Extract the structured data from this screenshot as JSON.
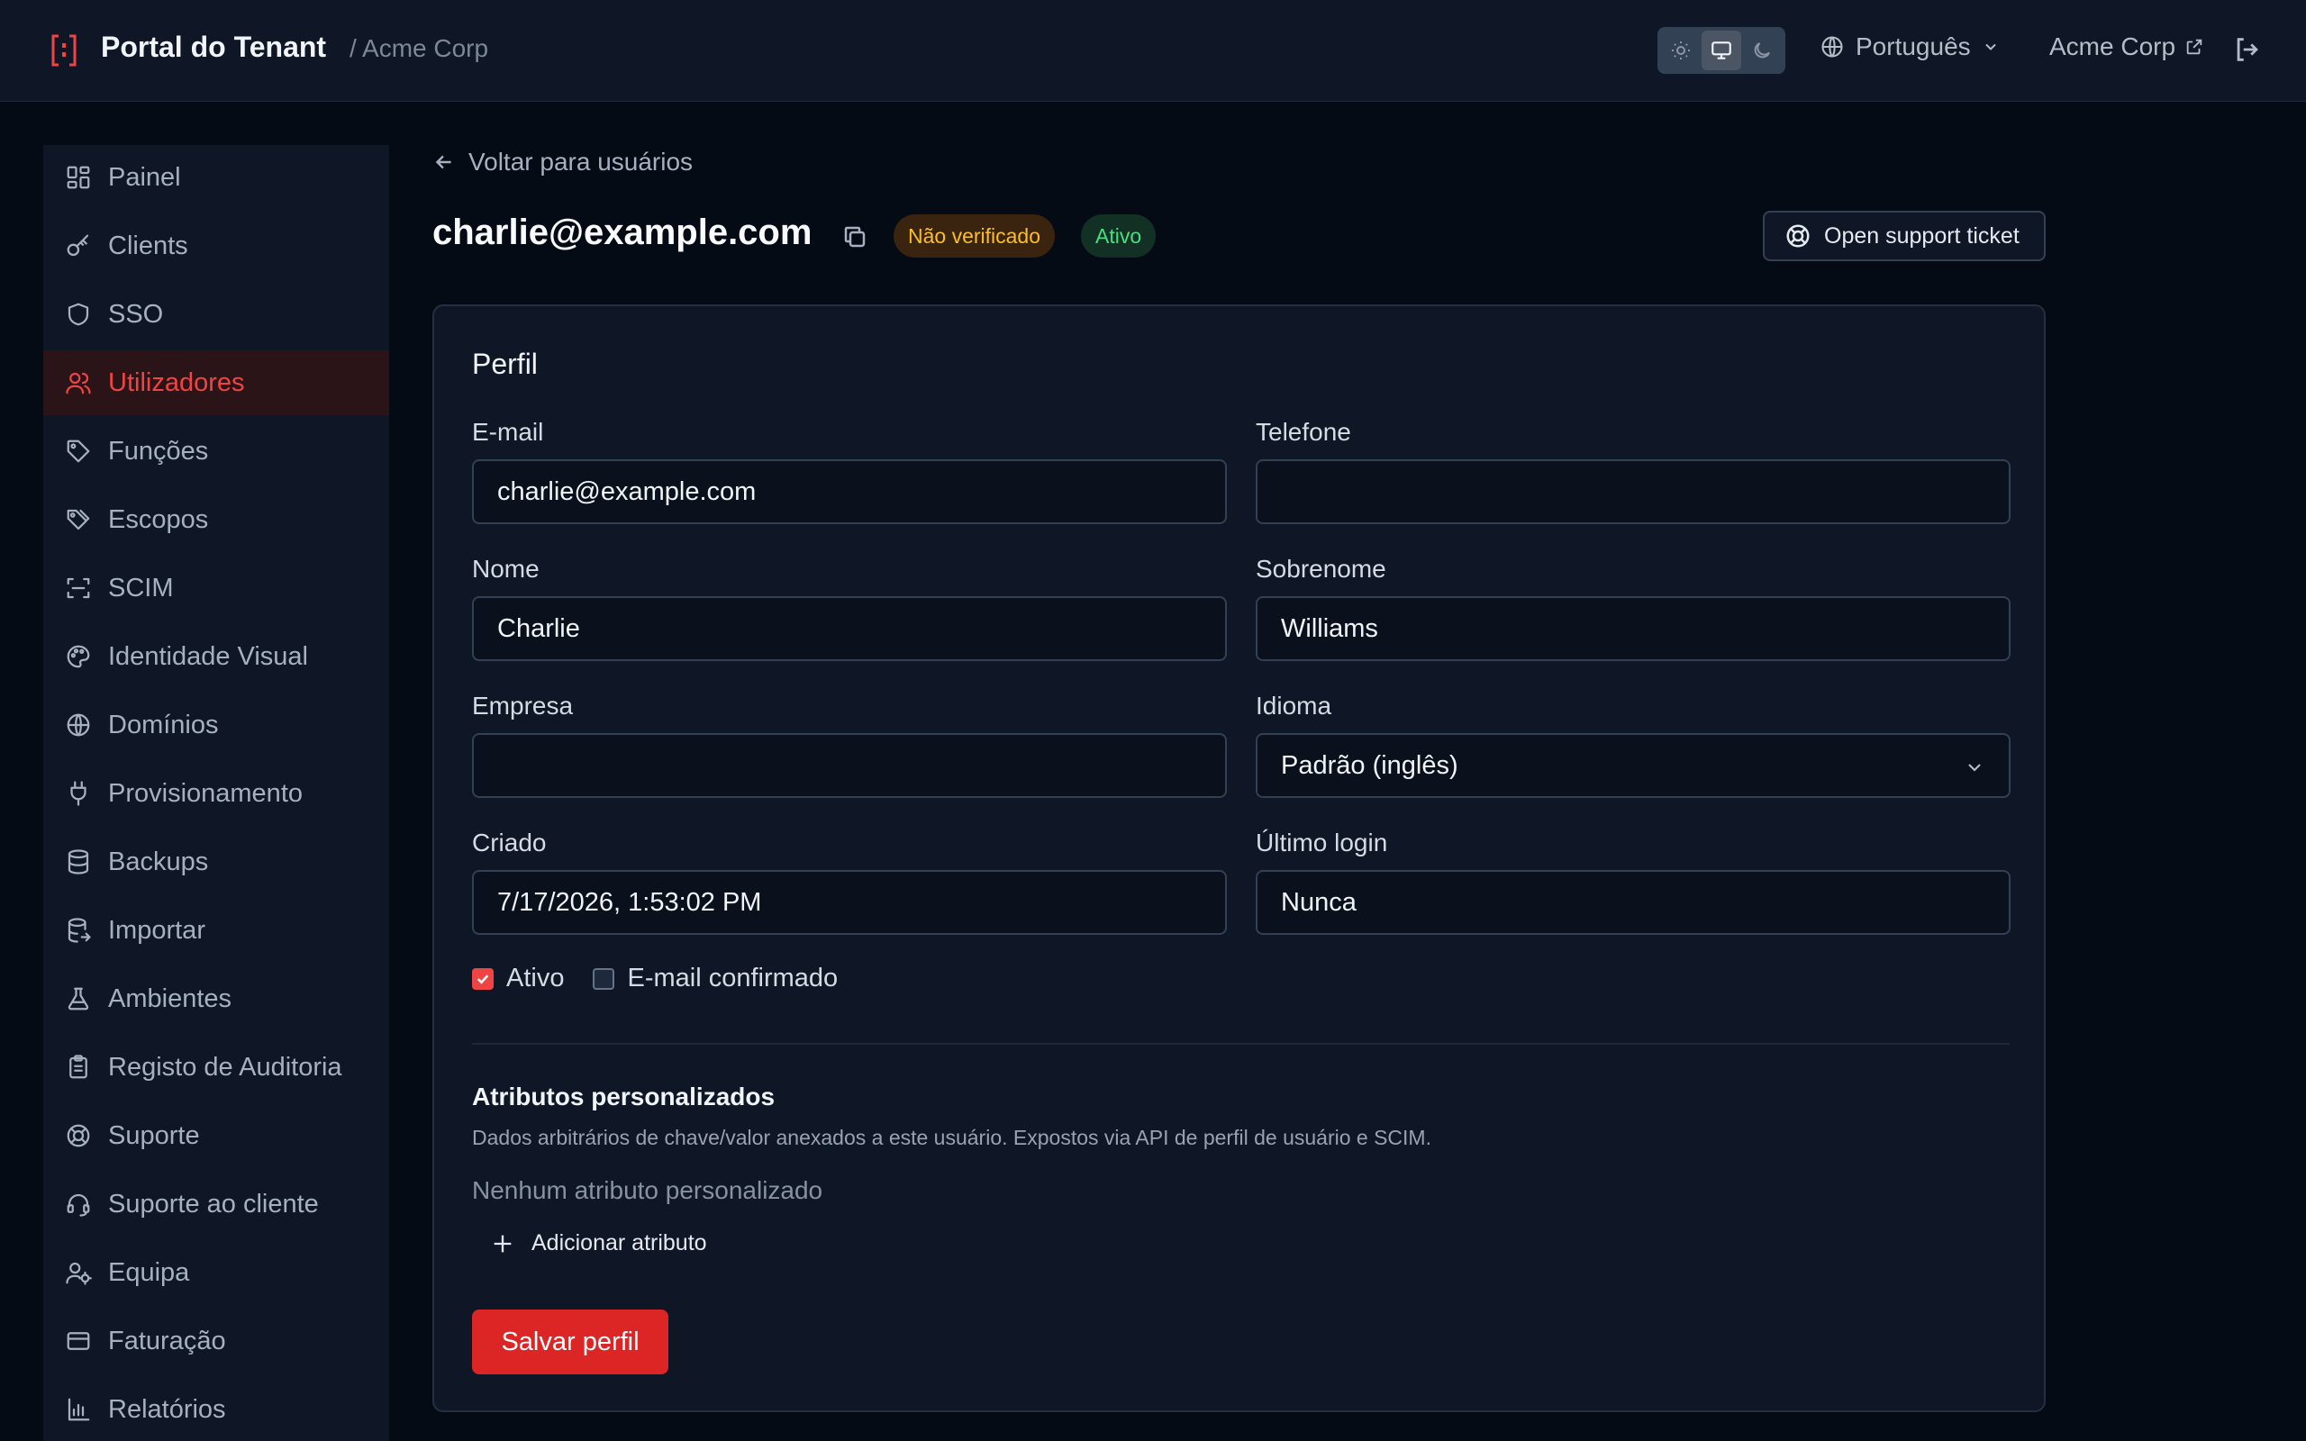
{
  "header": {
    "title": "Portal do Tenant",
    "tenant_crumb": "/ Acme Corp",
    "language": "Português",
    "tenant_link": "Acme Corp",
    "theme_options": [
      "light",
      "system",
      "dark"
    ],
    "theme_selected": "system"
  },
  "sidebar": {
    "items": [
      {
        "label": "Painel",
        "icon": "dashboard-icon"
      },
      {
        "label": "Clients",
        "icon": "key-icon"
      },
      {
        "label": "SSO",
        "icon": "shield-icon"
      },
      {
        "label": "Utilizadores",
        "icon": "users-icon",
        "active": true
      },
      {
        "label": "Funções",
        "icon": "tag-icon"
      },
      {
        "label": "Escopos",
        "icon": "tags-icon"
      },
      {
        "label": "SCIM",
        "icon": "scan-icon"
      },
      {
        "label": "Identidade Visual",
        "icon": "palette-icon"
      },
      {
        "label": "Domínios",
        "icon": "globe-icon"
      },
      {
        "label": "Provisionamento",
        "icon": "plug-icon"
      },
      {
        "label": "Backups",
        "icon": "database-icon"
      },
      {
        "label": "Importar",
        "icon": "database-import-icon"
      },
      {
        "label": "Ambientes",
        "icon": "flask-icon"
      },
      {
        "label": "Registo de Auditoria",
        "icon": "clipboard-icon"
      },
      {
        "label": "Suporte",
        "icon": "lifebuoy-icon"
      },
      {
        "label": "Suporte ao cliente",
        "icon": "headset-icon"
      },
      {
        "label": "Equipa",
        "icon": "user-cog-icon"
      },
      {
        "label": "Faturação",
        "icon": "credit-card-icon"
      },
      {
        "label": "Relatórios",
        "icon": "bar-chart-icon"
      }
    ]
  },
  "main": {
    "back_label": "Voltar para usuários",
    "user_email": "charlie@example.com",
    "badge_unverified": "Não verificado",
    "badge_active": "Ativo",
    "support_button": "Open support ticket"
  },
  "profile": {
    "title": "Perfil",
    "email_label": "E-mail",
    "email_value": "charlie@example.com",
    "phone_label": "Telefone",
    "phone_value": "",
    "first_name_label": "Nome",
    "first_name_value": "Charlie",
    "last_name_label": "Sobrenome",
    "last_name_value": "Williams",
    "company_label": "Empresa",
    "company_value": "",
    "language_label": "Idioma",
    "language_value": "Padrão (inglês)",
    "created_label": "Criado",
    "created_value": "7/17/2026, 1:53:02 PM",
    "last_login_label": "Último login",
    "last_login_value": "Nunca",
    "active_label": "Ativo",
    "active_checked": true,
    "email_confirmed_label": "E-mail confirmado",
    "email_confirmed_checked": false,
    "attributes_title": "Atributos personalizados",
    "attributes_desc": "Dados arbitrários de chave/valor anexados a este usuário. Expostos via API de perfil de usuário e SCIM.",
    "attributes_empty": "Nenhum atributo personalizado",
    "add_attribute": "Adicionar atributo",
    "save_button": "Salvar perfil"
  },
  "colors": {
    "accent": "#dc2626",
    "active_nav": "#ef4444",
    "warning_badge": "#fbbf24",
    "success_badge": "#4ade80"
  }
}
